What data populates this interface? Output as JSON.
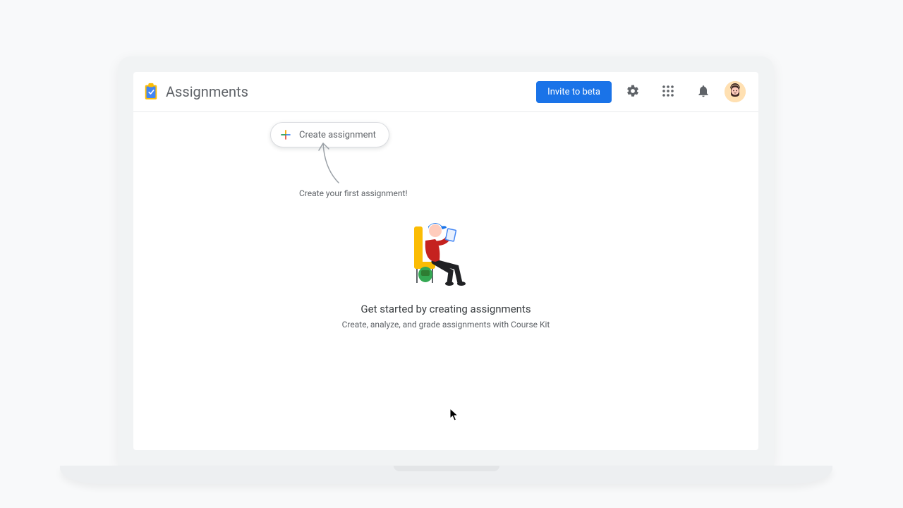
{
  "header": {
    "app_title": "Assignments",
    "invite_label": "Invite to beta"
  },
  "create_button": {
    "label": "Create assignment"
  },
  "hint": {
    "text": "Create your first assignment!"
  },
  "empty_state": {
    "headline": "Get started by creating assignments",
    "subline": "Create, analyze, and grade assignments with Course Kit"
  },
  "icons": {
    "settings": "gear-icon",
    "apps": "apps-grid-icon",
    "notifications": "bell-icon",
    "avatar": "user-avatar"
  },
  "colors": {
    "primary": "#1a73e8",
    "text_secondary": "#5f6368",
    "logo_yellow": "#fbbc04",
    "logo_blue": "#4285f4"
  }
}
